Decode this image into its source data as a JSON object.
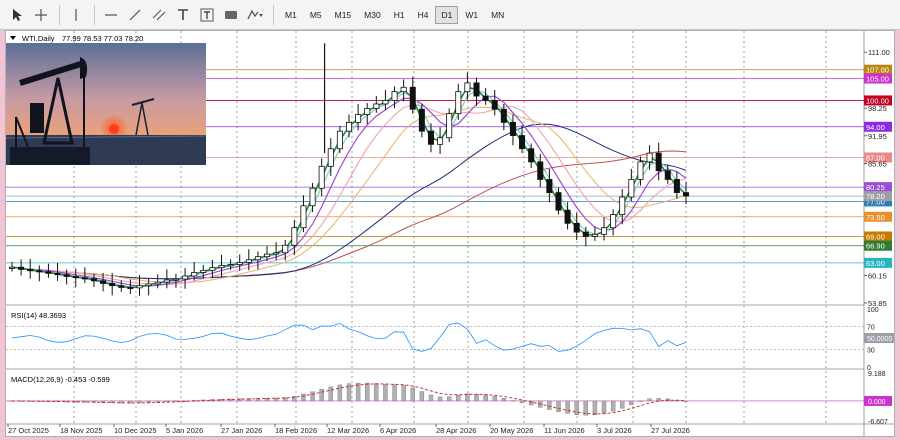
{
  "toolbar": {
    "tools": [
      "cursor-icon",
      "crosshair-icon",
      "vertical-line-icon",
      "horizontal-line-icon",
      "trendline-icon",
      "channel-icon",
      "text-icon",
      "text-label-icon",
      "rectangle-icon",
      "shapes-icon"
    ],
    "timeframes": [
      "M1",
      "M5",
      "M15",
      "M30",
      "H1",
      "H4",
      "D1",
      "W1",
      "MN"
    ],
    "active_timeframe": "D1"
  },
  "main": {
    "symbol": "WTI,Daily",
    "ohlc": "77.99 78.53 77.03 78.20",
    "price_labels": [
      "111.00",
      "98.25",
      "91.95",
      "85.65",
      "60.15",
      "53.85"
    ],
    "level_tags": [
      {
        "text": "107.00",
        "color": "#b8860b",
        "price": 107.0
      },
      {
        "text": "105.00",
        "color": "#cc33cc",
        "price": 105.0
      },
      {
        "text": "100.00",
        "color": "#c00020",
        "price": 100.0
      },
      {
        "text": "94.00",
        "color": "#8a2be2",
        "price": 94.0
      },
      {
        "text": "87.00",
        "color": "#e88a8a",
        "price": 87.0
      },
      {
        "text": "80.25",
        "color": "#9a4dd8",
        "price": 80.25
      },
      {
        "text": "77.00",
        "color": "#2a7fb8",
        "price": 77.0
      },
      {
        "text": "73.50",
        "color": "#e8902e",
        "price": 73.5
      },
      {
        "text": "69.00",
        "color": "#c47a00",
        "price": 69.0
      },
      {
        "text": "66.90",
        "color": "#2e7d32",
        "price": 66.9
      },
      {
        "text": "63.00",
        "color": "#26b5c0",
        "price": 63.0
      }
    ],
    "current_price": {
      "text": "78.20",
      "price": 78.2
    }
  },
  "rsi": {
    "label": "RSI(14) 48.3693",
    "ticks": [
      "100",
      "70",
      "50.0000",
      "30",
      "0"
    ]
  },
  "macd": {
    "label": "MACD(12,26,9) -0.453 -0.599",
    "ticks": [
      "9.188",
      "0.000",
      "-6.607"
    ]
  },
  "xaxis": {
    "labels": [
      "27 Oct 2025",
      "18 Nov 2025",
      "10 Dec 2025",
      "5 Jan 2026",
      "27 Jan 2026",
      "18 Feb 2026",
      "12 Mar 2026",
      "6 Apr 2026",
      "28 Apr 2026",
      "20 May 2026",
      "11 Jun 2026",
      "3 Jul 2026",
      "27 Jul 2026"
    ]
  },
  "chart_data": {
    "type": "line",
    "y_range": [
      53.85,
      114.0
    ],
    "close_series": [
      62.0,
      61.5,
      61.2,
      61.0,
      60.6,
      60.3,
      59.9,
      59.6,
      59.4,
      58.9,
      58.3,
      57.8,
      57.4,
      57.3,
      57.8,
      58.2,
      58.6,
      59.1,
      59.3,
      60.0,
      60.8,
      61.3,
      61.9,
      62.4,
      62.6,
      63.1,
      63.7,
      64.4,
      65.0,
      65.3,
      67.0,
      71.0,
      76.0,
      80.0,
      85.0,
      89.0,
      93.0,
      95.0,
      96.8,
      98.2,
      99.2,
      100.0,
      102.0,
      103.0,
      98.0,
      93.0,
      90.0,
      91.5,
      97.0,
      102.0,
      104.0,
      101.0,
      100.0,
      98.0,
      95.0,
      92.0,
      89.0,
      86.0,
      82.0,
      79.0,
      75.0,
      72.0,
      70.0,
      69.0,
      69.5,
      71.0,
      74.0,
      78.0,
      82.0,
      86.0,
      88.0,
      84.0,
      82.0,
      79.0,
      78.2
    ]
  }
}
